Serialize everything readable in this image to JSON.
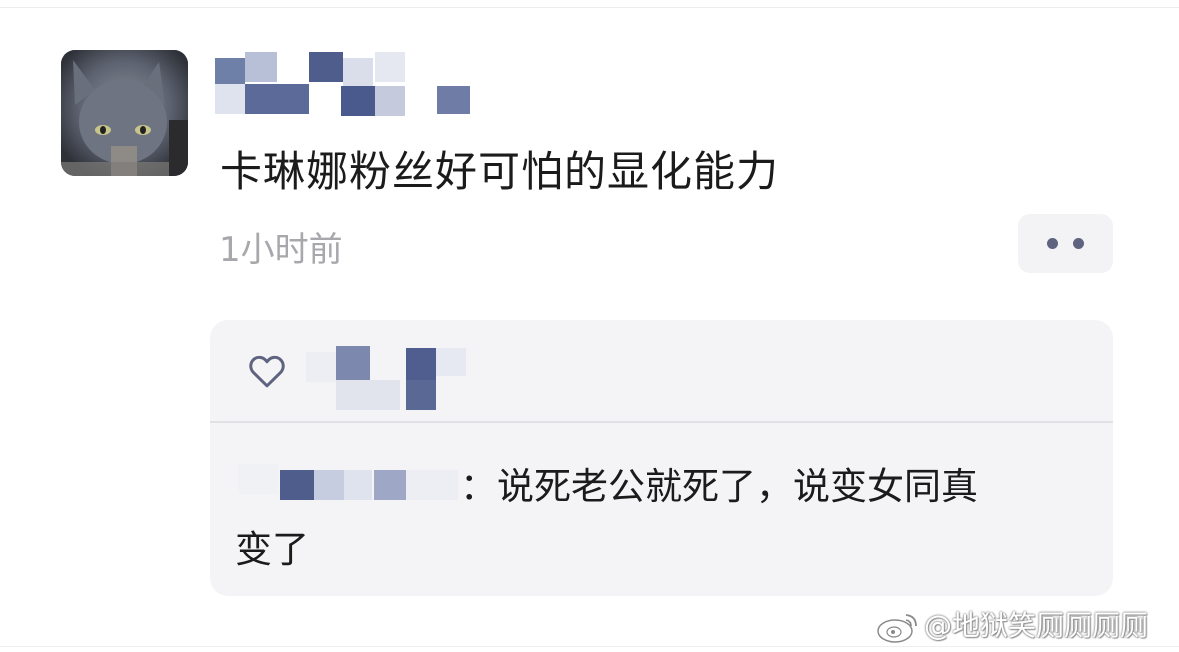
{
  "post": {
    "text": "卡琳娜粉丝好可怕的显化能力",
    "timestamp": "1小时前"
  },
  "comment": {
    "line1": "：说死老公就死了，说变女同真",
    "line2": "变了"
  },
  "watermark": {
    "text": "@地狱笑厕厕厕厕"
  },
  "colors": {
    "more_dots": "#5e6380",
    "mosaic_dark": "#4f5f8f",
    "panel_bg": "#f4f4f6"
  },
  "icons": [
    "cat-avatar",
    "more-dots-icon",
    "heart-icon",
    "weibo-logo-icon"
  ]
}
